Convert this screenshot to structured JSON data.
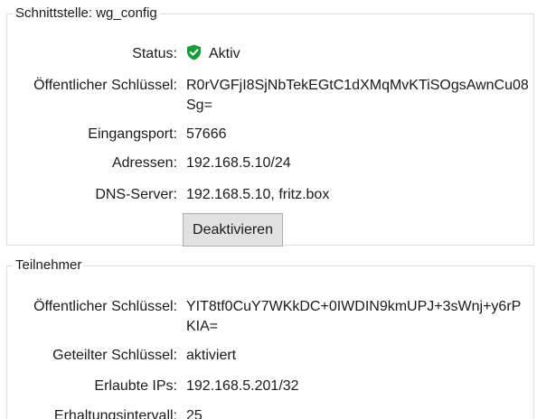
{
  "interface": {
    "legend": "Schnittstelle: wg_config",
    "status_label": "Status:",
    "status_value": "Aktiv",
    "status_color": "#1a9a3a",
    "public_key_label": "Öffentlicher Schlüssel:",
    "public_key_value": "R0rVGFjI8SjNbTekEGtC1dXMqMvKTiSOgsAwnCu08Sg=",
    "listen_port_label": "Eingangsport:",
    "listen_port_value": "57666",
    "addresses_label": "Adressen:",
    "addresses_value": "192.168.5.10/24",
    "dns_label": "DNS-Server:",
    "dns_value": "192.168.5.10, fritz.box",
    "deactivate_button": "Deaktivieren"
  },
  "peer": {
    "legend": "Teilnehmer",
    "public_key_label": "Öffentlicher Schlüssel:",
    "public_key_value": "YIT8tf0CuY7WKkDC+0IWDIN9kmUPJ+3sWnj+y6rPKIA=",
    "preshared_key_label": "Geteilter Schlüssel:",
    "preshared_key_value": "aktiviert",
    "allowed_ips_label": "Erlaubte IPs:",
    "allowed_ips_value": "192.168.5.201/32",
    "keepalive_label": "Erhaltungsintervall:",
    "keepalive_value": "25"
  },
  "icons": {
    "status": "shield-check-icon"
  }
}
